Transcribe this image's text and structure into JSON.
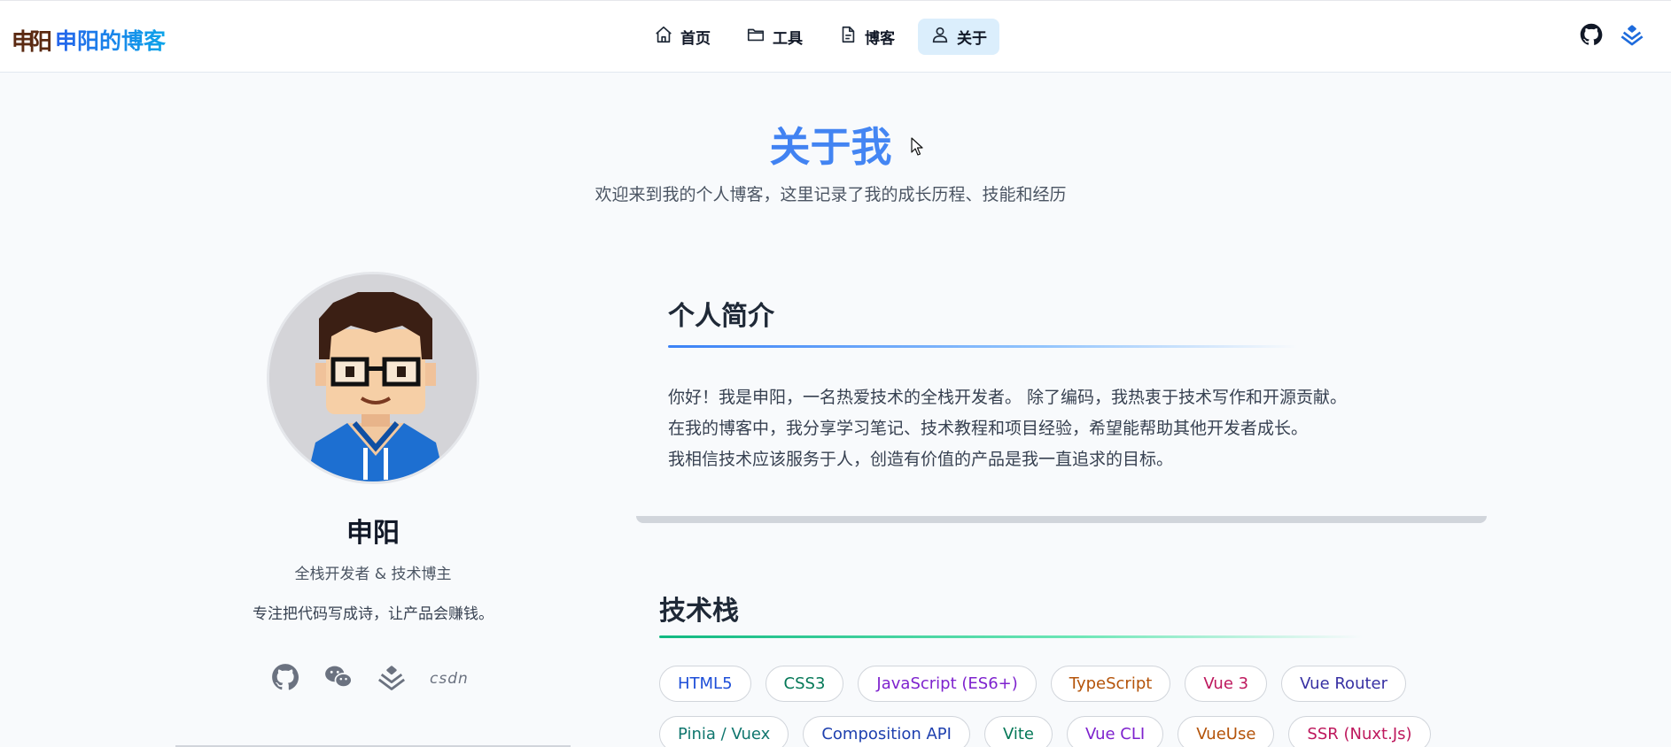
{
  "header": {
    "logo_mark": "申阳",
    "site_name": "申阳的博客",
    "nav": [
      {
        "label": "首页",
        "icon": "home-icon",
        "active": false
      },
      {
        "label": "工具",
        "icon": "folder-icon",
        "active": false
      },
      {
        "label": "博客",
        "icon": "document-icon",
        "active": false
      },
      {
        "label": "关于",
        "icon": "user-icon",
        "active": true
      }
    ],
    "right_icons": [
      "github-icon",
      "juejin-icon"
    ]
  },
  "hero": {
    "title": "关于我",
    "subtitle": "欢迎来到我的个人博客，这里记录了我的成长历程、技能和经历"
  },
  "profile": {
    "name": "申阳",
    "role": "全栈开发者 & 技术博主",
    "motto": "专注把代码写成诗，让产品会赚钱。",
    "social": {
      "icons": [
        "github-icon",
        "wechat-icon",
        "juejin-icon"
      ],
      "csdn_label": "csdn"
    }
  },
  "intro": {
    "title": "个人简介",
    "lines": [
      "你好！我是申阳，一名热爱技术的全栈开发者。 除了编码，我热衷于技术写作和开源贡献。",
      "在我的博客中，我分享学习笔记、技术教程和项目经验，希望能帮助其他开发者成长。",
      "我相信技术应该服务于人，创造有价值的产品是我一直追求的目标。"
    ]
  },
  "tech": {
    "title": "技术栈",
    "tags": [
      {
        "label": "HTML5",
        "color": "#1d4ed8"
      },
      {
        "label": "CSS3",
        "color": "#047857"
      },
      {
        "label": "JavaScript (ES6+)",
        "color": "#7e22ce"
      },
      {
        "label": "TypeScript",
        "color": "#b45309"
      },
      {
        "label": "Vue 3",
        "color": "#be185d"
      },
      {
        "label": "Vue Router",
        "color": "#3730a3"
      },
      {
        "label": "Pinia / Vuex",
        "color": "#0f766e"
      },
      {
        "label": "Composition API",
        "color": "#1e40af"
      },
      {
        "label": "Vite",
        "color": "#047857"
      },
      {
        "label": "Vue CLI",
        "color": "#7e22ce"
      },
      {
        "label": "VueUse",
        "color": "#b45309"
      },
      {
        "label": "SSR (Nuxt.Js)",
        "color": "#be185d"
      }
    ]
  },
  "colors": {
    "accent": "#2563eb",
    "nav_active_bg": "#dbeefc",
    "intro_line": "#3b82f6",
    "tech_line": "#10b981"
  }
}
